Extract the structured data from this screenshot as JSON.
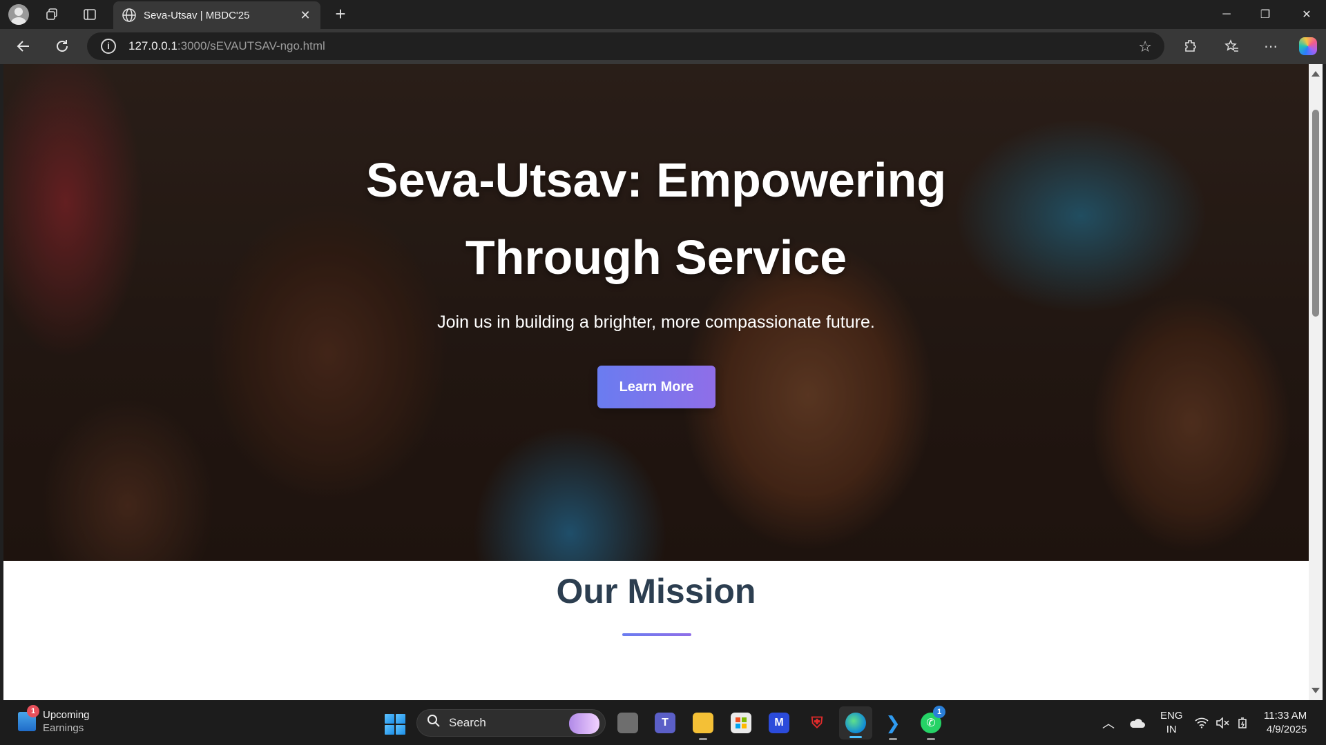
{
  "browser": {
    "tab": {
      "title": "Seva-Utsav | MBDC'25",
      "close": "✕"
    },
    "new_tab": "+",
    "url": {
      "host": "127.0.0.1",
      "path": ":3000/sEVAUTSAV-ngo.html"
    },
    "window_controls": {
      "minimize": "─",
      "maximize": "❐",
      "close": "✕"
    }
  },
  "page": {
    "hero": {
      "title_line1": "Seva-Utsav: Empowering",
      "title_line2": "Through Service",
      "subtitle": "Join us in building a brighter, more compassionate future.",
      "cta_label": "Learn More"
    },
    "mission": {
      "title": "Our Mission"
    }
  },
  "taskbar": {
    "widget": {
      "line1": "Upcoming",
      "line2": "Earnings",
      "badge": "1"
    },
    "search_label": "Search",
    "whatsapp_badge": "1",
    "tray": {
      "lang_line1": "ENG",
      "lang_line2": "IN",
      "time": "11:33 AM",
      "date": "4/9/2025"
    }
  },
  "colors": {
    "accent_gradient_start": "#6a7cf0",
    "accent_gradient_end": "#8f6ee8",
    "mission_title": "#2c3e50"
  }
}
